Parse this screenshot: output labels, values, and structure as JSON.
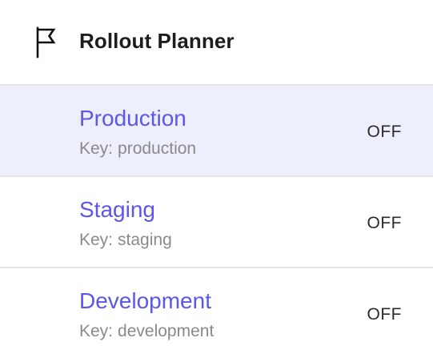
{
  "header": {
    "icon": "flag-icon",
    "title": "Rollout Planner"
  },
  "colors": {
    "accent": "#5b57e8",
    "selected_row_bg": "#eeeffc",
    "divider": "#e6e6e6",
    "muted_text": "#8a8a8a"
  },
  "environments": [
    {
      "name": "Production",
      "key_label": "Key:",
      "key": "production",
      "status": "OFF",
      "selected": true
    },
    {
      "name": "Staging",
      "key_label": "Key:",
      "key": "staging",
      "status": "OFF",
      "selected": false
    },
    {
      "name": "Development",
      "key_label": "Key:",
      "key": "development",
      "status": "OFF",
      "selected": false
    }
  ]
}
